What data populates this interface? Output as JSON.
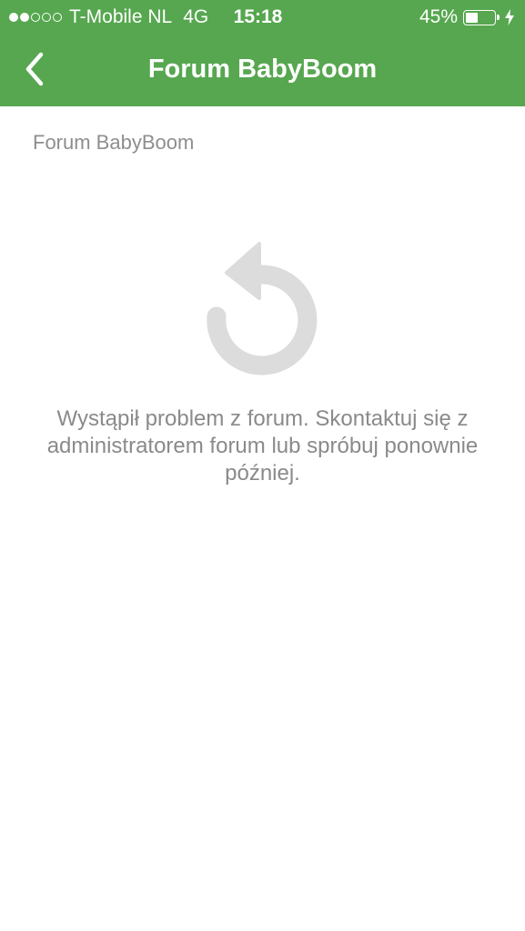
{
  "status_bar": {
    "signal_dots": "●●○○○",
    "carrier": "T-Mobile NL",
    "network": "4G",
    "time": "15:18",
    "battery_percent": "45%",
    "battery_level": 0.45,
    "charging_icon": "lightning-bolt-icon"
  },
  "nav": {
    "back_icon": "chevron-left-icon",
    "title": "Forum BabyBoom"
  },
  "content": {
    "breadcrumb": "Forum BabyBoom",
    "reload_icon": "reload-icon",
    "error_message": "Wystąpił problem z forum. Skontaktuj się z administratorem forum lub spróbuj ponownie później."
  },
  "colors": {
    "header_bg": "#56a74f",
    "text_muted": "#8a8a8a",
    "icon_gray": "#dcdcdc"
  }
}
